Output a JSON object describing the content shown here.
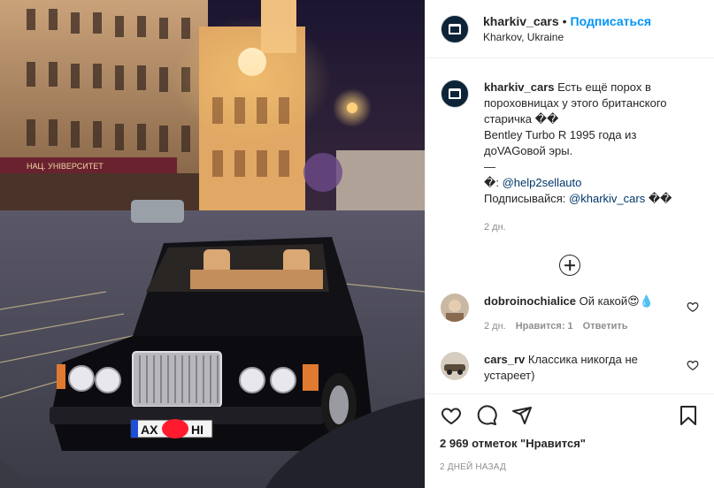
{
  "post": {
    "username": "kharkiv_cars",
    "separator": "•",
    "follow_label": "Подписаться",
    "location": "Kharkov, Ukraine"
  },
  "caption": {
    "username": "kharkiv_cars",
    "text": " Есть ещё порох в пороховницах у этого британского старичка ��",
    "line2": "Bentley Turbo R 1995 года из доVAGовой эры.",
    "line3": "—",
    "credit_prefix": "�: ",
    "credit_link": "@help2sellauto",
    "subscribe_prefix": "Подписывайся: ",
    "subscribe_link": "@kharkiv_cars",
    "subscribe_suffix": " ��",
    "time": "2 дн."
  },
  "comments": [
    {
      "username": "dobroinochialice",
      "text": " Ой какой😍💧",
      "time": "2 дн.",
      "likes": "Нравится: 1",
      "reply": "Ответить"
    },
    {
      "username": "cars_rv",
      "text": " Классика никогда не устареет)"
    }
  ],
  "footer": {
    "likes": "2 969 отметок \"Нравится\"",
    "time_ago": "2 ДНЕЙ НАЗАД"
  },
  "photo": {
    "plate_left": "AX",
    "plate_right": "HI",
    "sign_text": "НАЦ. УНІВЕРСИТЕТ"
  },
  "icons": {
    "like": "heart-icon",
    "comment": "comment-bubble-icon",
    "share": "paper-plane-icon",
    "save": "bookmark-icon",
    "more": "plus-circle-icon"
  },
  "colors": {
    "accent": "#0095f6",
    "link": "#00376b",
    "muted": "#8e8e8e",
    "text": "#262626"
  }
}
